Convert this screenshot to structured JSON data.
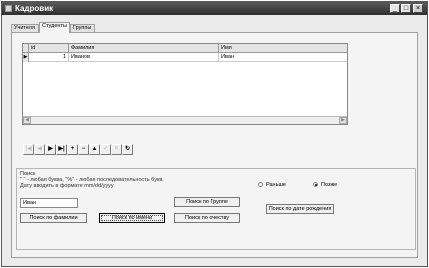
{
  "window": {
    "title": "Кадровик",
    "minimize": "_",
    "maximize": "□",
    "close": "×"
  },
  "tabs": [
    "Учителя",
    "Студенты",
    "Группы"
  ],
  "active_tab": "Студенты",
  "grid": {
    "columns": [
      "id",
      "Фамилия",
      "Имя"
    ],
    "rows": [
      {
        "indicator": "▶",
        "cells": [
          "1",
          "Иванов",
          "Иван"
        ]
      }
    ],
    "scroll_left": "◀",
    "scroll_right": "▶"
  },
  "navigator": {
    "buttons": [
      {
        "name": "first",
        "glyph": "|◀",
        "enabled": false
      },
      {
        "name": "prior",
        "glyph": "◀",
        "enabled": false
      },
      {
        "name": "next",
        "glyph": "▶",
        "enabled": true
      },
      {
        "name": "last",
        "glyph": "▶|",
        "enabled": true
      },
      {
        "name": "insert",
        "glyph": "+",
        "enabled": true
      },
      {
        "name": "delete",
        "glyph": "−",
        "enabled": true
      },
      {
        "name": "edit",
        "glyph": "▲",
        "enabled": true
      },
      {
        "name": "post",
        "glyph": "✓",
        "enabled": false
      },
      {
        "name": "cancel",
        "glyph": "✕",
        "enabled": false
      },
      {
        "name": "refresh",
        "glyph": "↻",
        "enabled": true
      }
    ]
  },
  "search": {
    "group_title": "Поиск",
    "hint_line1": "\" \" - любая буква, \"%\" - любая последовательность букв.",
    "hint_line2": "Дату вводить в формате mm/dd/yyyy",
    "input_value": "Иван",
    "radio_earlier": "Раньше",
    "radio_later": "Позже",
    "radio_selected": "Позже",
    "btn_by_group": "Поиск по Группе",
    "btn_by_birthdate": "Поиск по дате рождения",
    "btn_by_surname": "Поиск по фамилии",
    "btn_by_name": "Поиск по имени",
    "btn_by_patronymic": "Поиск по очеству"
  }
}
